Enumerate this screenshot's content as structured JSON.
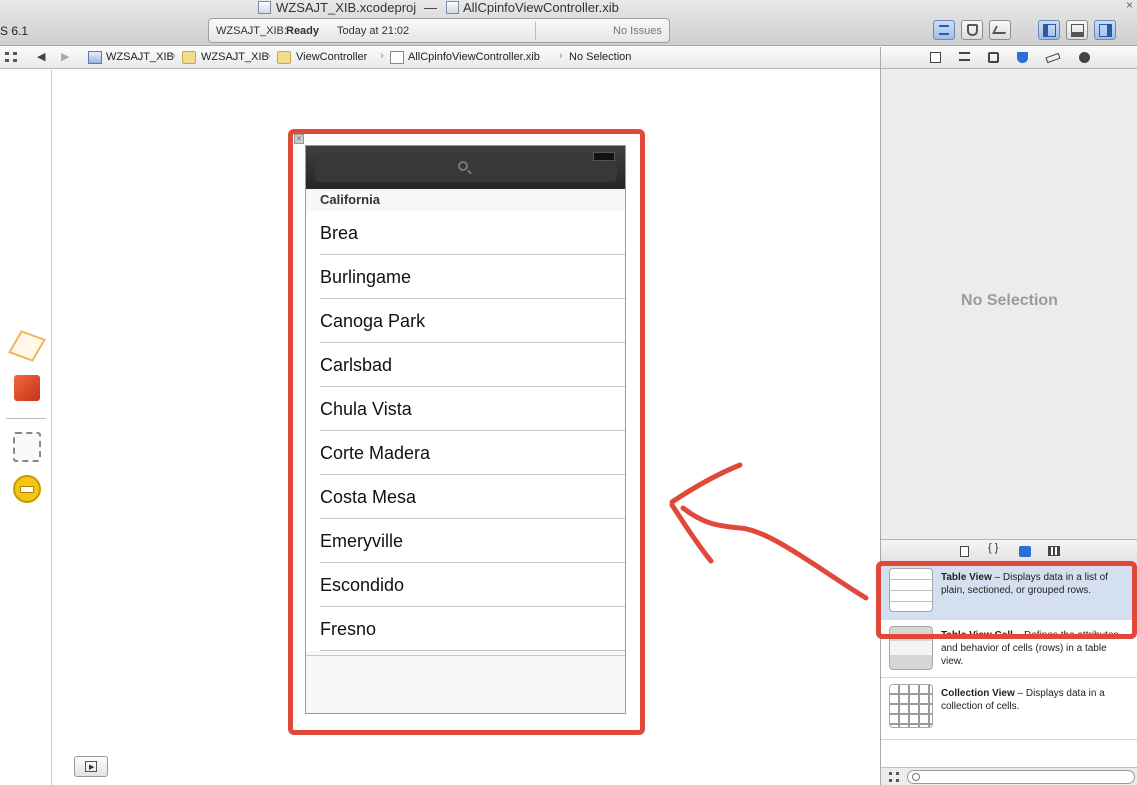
{
  "window": {
    "project_title": "WZSAJT_XIB.xcodeproj",
    "title_separator": "—",
    "file_title": "AllCpinfoViewController.xib",
    "ios_version": "S 6.1"
  },
  "status_bar": {
    "scheme": "WZSAJT_XIB:",
    "state": "Ready",
    "time": "Today at 21:02",
    "issues": "No Issues"
  },
  "jump_bar": {
    "crumbs": [
      "WZSAJT_XIB",
      "WZSAJT_XIB",
      "ViewController",
      "AllCpinfoViewController.xib",
      "No Selection"
    ]
  },
  "inspector": {
    "placeholder": "No Selection"
  },
  "table": {
    "section_header": "California",
    "rows": [
      "Brea",
      "Burlingame",
      "Canoga Park",
      "Carlsbad",
      "Chula Vista",
      "Corte Madera",
      "Costa Mesa",
      "Emeryville",
      "Escondido",
      "Fresno"
    ]
  },
  "library": {
    "items": [
      {
        "name": "Table View",
        "desc": " – Displays data in a list of plain, sectioned, or grouped rows.",
        "icon": "table-view-icon"
      },
      {
        "name": "Table View Cell",
        "desc": " – Defines the attributes and behavior of cells (rows) in a table view.",
        "icon": "table-view-cell-icon"
      },
      {
        "name": "Collection View",
        "desc": " – Displays data in a collection of cells.",
        "icon": "collection-view-icon"
      }
    ]
  },
  "colors": {
    "annotation": "#e0493a",
    "selection": "#d4dff0",
    "search_bar": "#2a2a2a"
  }
}
